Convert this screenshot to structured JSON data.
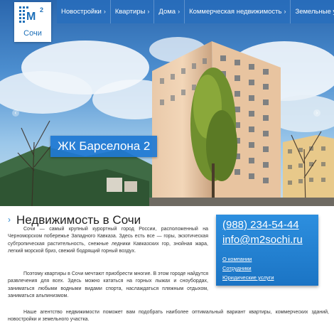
{
  "nav": {
    "items": [
      {
        "label": "Новостройки"
      },
      {
        "label": "Квартиры"
      },
      {
        "label": "Дома"
      },
      {
        "label": "Коммерческая недвижимость"
      },
      {
        "label": "Земельные участки"
      }
    ]
  },
  "logo": {
    "mark": "M",
    "superscript": "2",
    "city": "Сочи"
  },
  "slider": {
    "caption": "ЖК Барселона 2",
    "prev_icon": "chevron-left-icon",
    "next_icon": "chevron-right-icon"
  },
  "main": {
    "title": "Недвижимость в Сочи",
    "paragraphs": [
      "Сочи — самый крупный курортный город России, расположенный на Черноморском побережье Западного Кавказа. Здесь есть все — горы, экзотическая субтропическая растительность, снежные ледники Кавказских гор, знойная жара, легкий морской бриз, свежий бодрящий горный воздух.",
      "Поэтому квартиры в Сочи мечтают приобрести многие. В этом городе найдутся развлечения для всех. Здесь можно кататься на горных лыжах и сноубордах, заниматься любыми водными видами спорта, наслаждаться пляжным отдыхом, заниматься альпинизмом.",
      "Наше агентство недвижимости поможет вам подобрать наиболее оптимальный вариант квартиры, коммерческих зданий, новостройки и земельного участка."
    ]
  },
  "sidebar": {
    "phone": "(988) 234-54-44",
    "email": "info@m2sochi.ru",
    "links": [
      {
        "label": "О компании"
      },
      {
        "label": "Сотрудники"
      },
      {
        "label": "Юридические услуги"
      }
    ]
  },
  "colors": {
    "accent": "#1e78d2",
    "nav_bg": "#286ebe"
  }
}
